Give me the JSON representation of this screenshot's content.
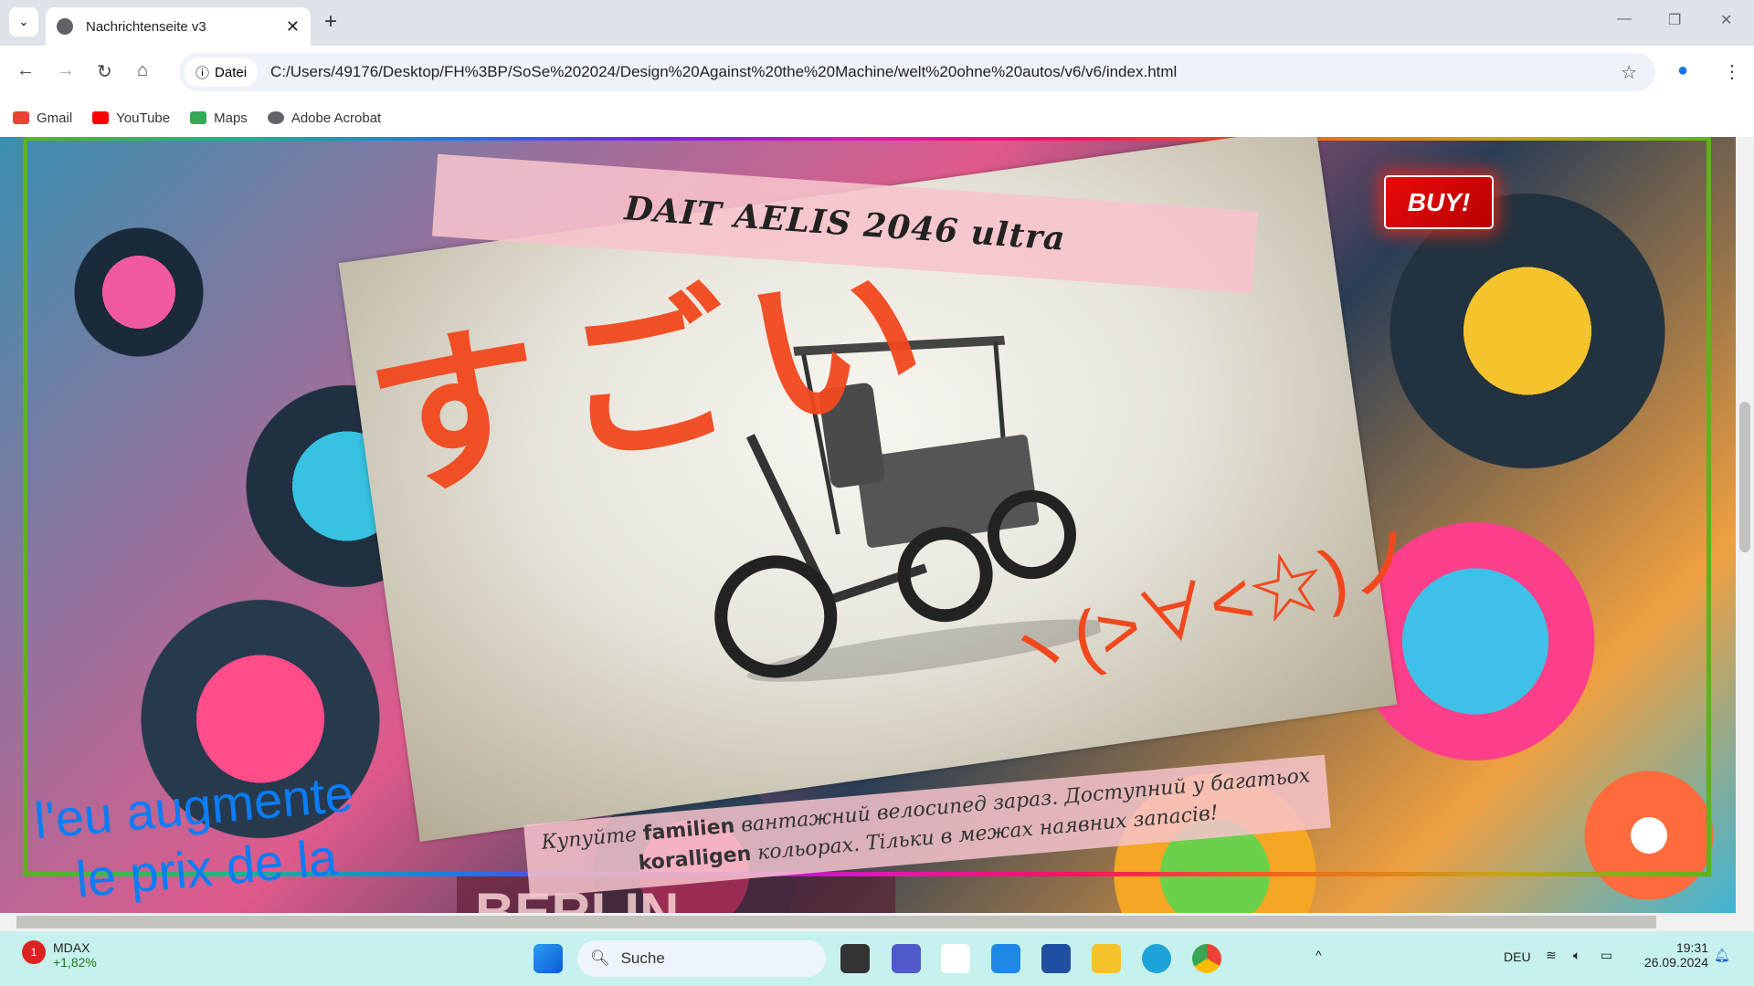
{
  "browser": {
    "tab_title": "Nachrichtenseite v3",
    "address_chip": "Datei",
    "url": "C:/Users/49176/Desktop/FH%3BP/SoSe%202024/Design%20Against%20the%20Machine/welt%20ohne%20autos/v6/v6/index.html",
    "bookmarks": [
      {
        "label": "Gmail",
        "color": "#ea4335"
      },
      {
        "label": "YouTube",
        "color": "#ff0000"
      },
      {
        "label": "Maps",
        "color": "#34a853"
      },
      {
        "label": "Adobe Acrobat",
        "color": "#5f6368"
      }
    ]
  },
  "page": {
    "product_title": "DAIT AELIS 2046 ultra",
    "sugoi": "すごい",
    "kaomoji": "ヽ(>∀<☆)ノ",
    "buy_label": "BUY!",
    "promo_part1": "Купуйте ",
    "promo_bold1": "familien",
    "promo_part2": " вантажний велосипед зараз. Доступний у багатьох ",
    "promo_bold2": "koralligen",
    "promo_part3": " кольорах. Тільки в межах наявних запасів!",
    "french_line1": "l'eu augmente",
    "french_line2": "le prix de la",
    "below_text": "BERLIN",
    "accent": "#5fb21c",
    "buy_color": "#e80a0a"
  },
  "taskbar": {
    "widget_name": "MDAX",
    "widget_value": "+1,82%",
    "widget_badge": "1",
    "search_placeholder": "Suche",
    "language": "DEU",
    "time": "19:31",
    "date": "26.09.2024"
  }
}
